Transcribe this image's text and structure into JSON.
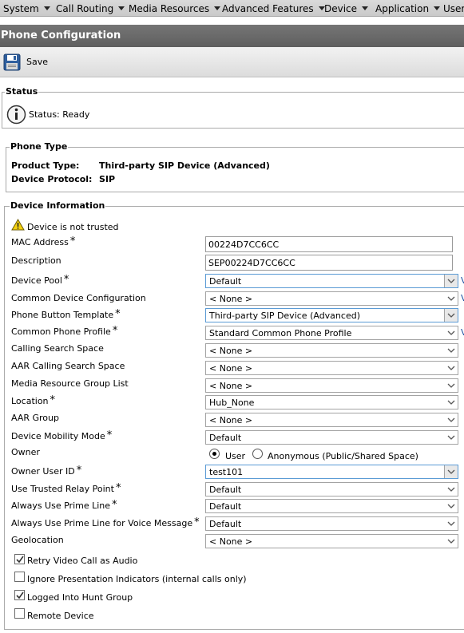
{
  "menu": [
    {
      "label": "System"
    },
    {
      "label": "Call Routing"
    },
    {
      "label": "Media Resources"
    },
    {
      "label": "Advanced Features"
    },
    {
      "label": "Device"
    },
    {
      "label": "Application"
    },
    {
      "label": "User"
    }
  ],
  "page_title": "Phone Configuration",
  "toolbar": {
    "save_label": "Save",
    "save_icon": "floppy-disk-icon"
  },
  "status": {
    "legend": "Status",
    "icon": "info-icon",
    "text": "Status: Ready"
  },
  "phone_type": {
    "legend": "Phone Type",
    "product_label": "Product Type:",
    "product_value": "Third-party SIP Device (Advanced)",
    "protocol_label": "Device Protocol:",
    "protocol_value": "SIP"
  },
  "device_info": {
    "legend": "Device Information",
    "trust_icon": "warning-icon",
    "trust_text": "Device is not trusted",
    "mac_label": "MAC Address",
    "mac_value": "00224D7CC6CC",
    "description_label": "Description",
    "description_value": "SEP00224D7CC6CC",
    "fields": [
      {
        "label": "Device Pool",
        "value": "Default",
        "required": "*",
        "link": "V"
      },
      {
        "label": "Common Device Configuration",
        "value": "< None >",
        "required": "",
        "link": "V"
      },
      {
        "label": "Phone Button Template",
        "value": "Third-party SIP Device (Advanced)",
        "required": "*",
        "link": ""
      },
      {
        "label": "Common Phone Profile",
        "value": "Standard Common Phone Profile",
        "required": "*",
        "link": "V"
      },
      {
        "label": "Calling Search Space",
        "value": "< None >",
        "required": "",
        "link": ""
      },
      {
        "label": "AAR Calling Search Space",
        "value": "< None >",
        "required": "",
        "link": ""
      },
      {
        "label": "Media Resource Group List",
        "value": "< None >",
        "required": "",
        "link": ""
      },
      {
        "label": "Location",
        "value": "Hub_None",
        "required": "*",
        "link": ""
      },
      {
        "label": "AAR Group",
        "value": "< None >",
        "required": "",
        "link": ""
      },
      {
        "label": "Device Mobility Mode",
        "value": "Default",
        "required": "*",
        "link": ""
      }
    ],
    "owner_label": "Owner",
    "owner_options": [
      "User",
      "Anonymous (Public/Shared Space)"
    ],
    "owner_selected": "User",
    "owner_user_label": "Owner User ID",
    "owner_user_value": "test101",
    "fields2": [
      {
        "label": "Use Trusted Relay Point",
        "value": "Default",
        "required": "*"
      },
      {
        "label": "Always Use Prime Line",
        "value": "Default",
        "required": "*"
      },
      {
        "label": "Always Use Prime Line for Voice Message",
        "value": "Default",
        "required": "*"
      },
      {
        "label": "Geolocation",
        "value": "< None >",
        "required": ""
      }
    ],
    "checkboxes": [
      {
        "label": "Retry Video Call as Audio",
        "checked": true
      },
      {
        "label": "Ignore Presentation Indicators (internal calls only)",
        "checked": false
      },
      {
        "label": "Logged Into Hunt Group",
        "checked": true
      },
      {
        "label": "Remote Device",
        "checked": false
      }
    ],
    "required_mark": "*"
  }
}
